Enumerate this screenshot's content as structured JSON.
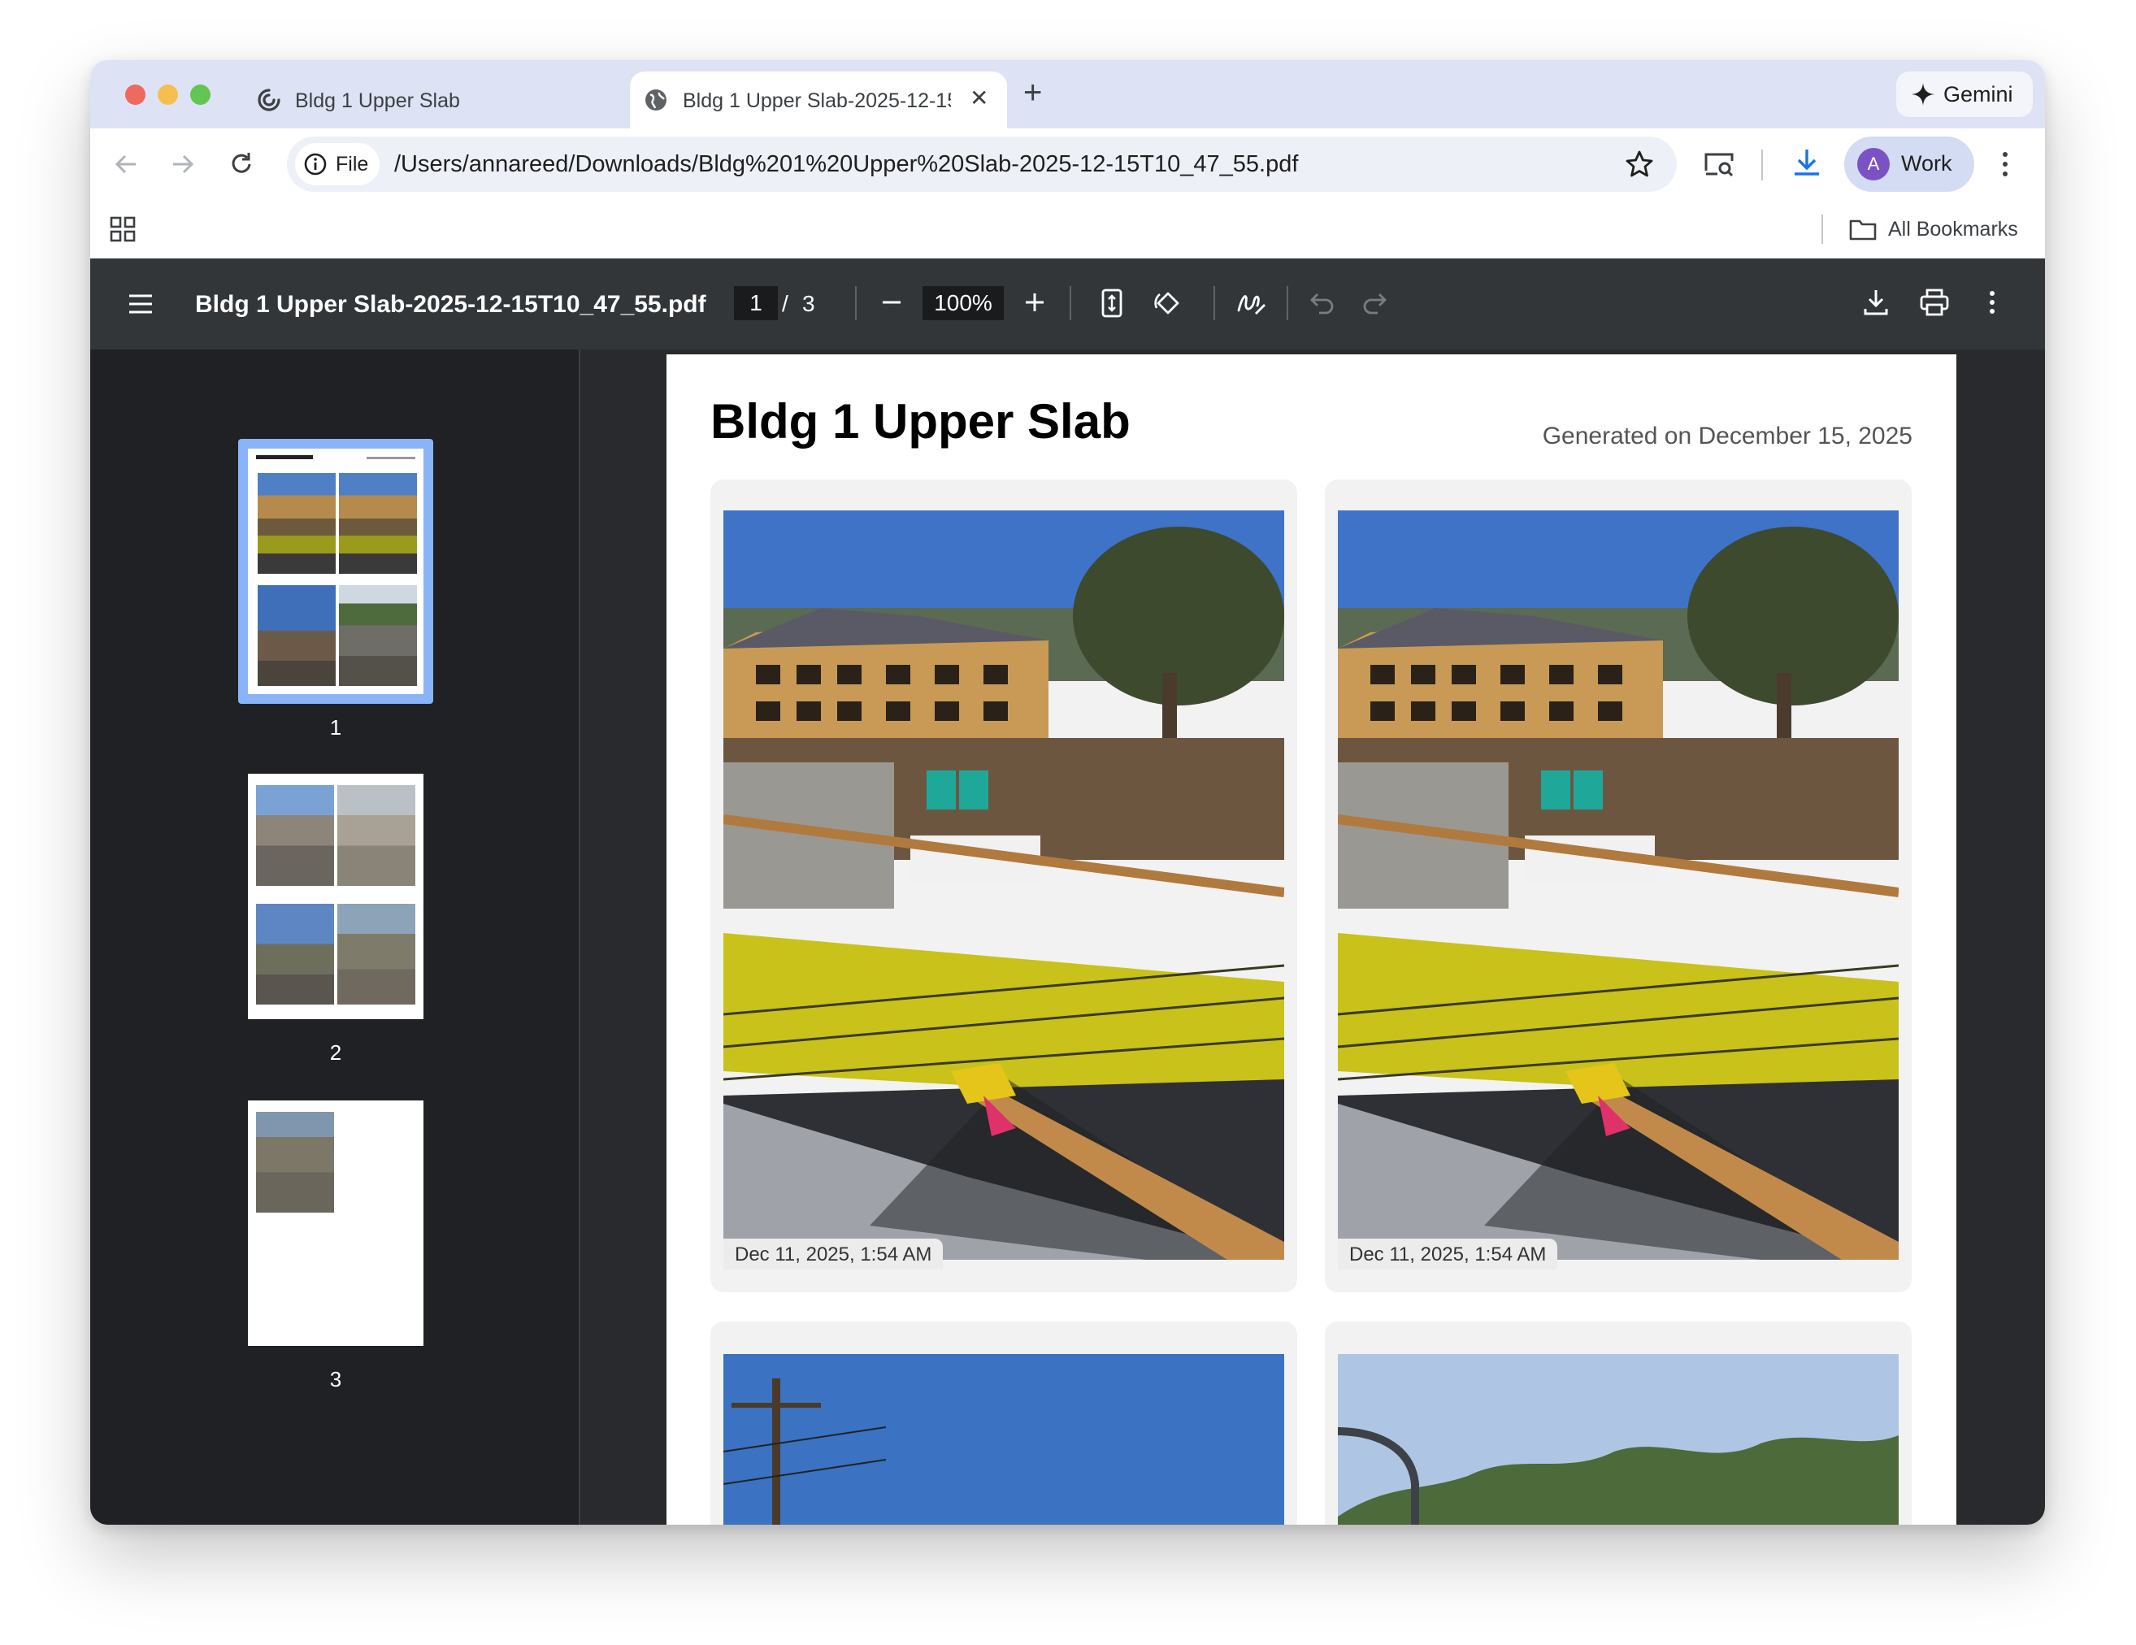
{
  "tabs": [
    {
      "title": "Bldg 1 Upper Slab"
    },
    {
      "title": "Bldg 1 Upper Slab-2025-12-15T10_47_55.pdf"
    }
  ],
  "gemini_label": "Gemini",
  "omnibox": {
    "scheme_label": "File",
    "url": "/Users/annareed/Downloads/Bldg%201%20Upper%20Slab-2025-12-15T10_47_55.pdf"
  },
  "profile": {
    "initial": "A",
    "name": "Work"
  },
  "bookmarks": {
    "all_label": "All Bookmarks"
  },
  "pdf_toolbar": {
    "filename": "Bldg 1 Upper Slab-2025-12-15T10_47_55.pdf",
    "current_page": "1",
    "page_separator": "/",
    "total_pages": "3",
    "zoom": "100%"
  },
  "thumbnails": [
    {
      "number": "1"
    },
    {
      "number": "2"
    },
    {
      "number": "3"
    }
  ],
  "document": {
    "title": "Bldg 1 Upper Slab",
    "generated": "Generated on December 15, 2025",
    "photos": [
      {
        "caption": "Dec 11, 2025, 1:54 AM"
      },
      {
        "caption": "Dec 11, 2025, 1:54 AM"
      }
    ]
  }
}
